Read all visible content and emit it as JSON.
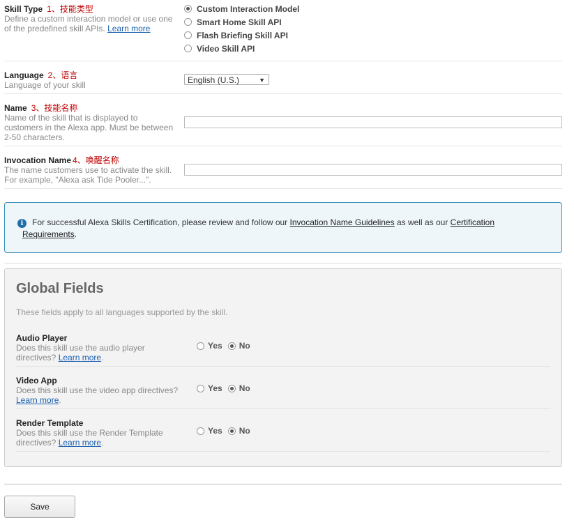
{
  "skill_type": {
    "title": "Skill Type",
    "annotation": "1、技能类型",
    "desc": "Define a custom interaction model or use one of the predefined skill APIs.",
    "learn_more": "Learn more",
    "options": [
      {
        "label": "Custom Interaction Model",
        "checked": true
      },
      {
        "label": "Smart Home Skill API",
        "checked": false
      },
      {
        "label": "Flash Briefing Skill API",
        "checked": false
      },
      {
        "label": "Video Skill API",
        "checked": false
      }
    ]
  },
  "language": {
    "title": "Language",
    "annotation": "2、语言",
    "desc": "Language of your skill",
    "selected": "English (U.S.)"
  },
  "name": {
    "title": "Name",
    "annotation": "3、技能名称",
    "desc": "Name of the skill that is displayed to customers in the Alexa app. Must be between 2-50 characters.",
    "value": ""
  },
  "invocation_name": {
    "title": "Invocation Name",
    "annotation": "4、唤醒名称",
    "desc": "The name customers use to activate the skill. For example, \"Alexa ask Tide Pooler...\".",
    "value": ""
  },
  "notice": {
    "text_before": "For successful Alexa Skills Certification, please review and follow our",
    "link1": "Invocation Name Guidelines",
    "text_middle": "as well as our",
    "link2": "Certification Requirements",
    "text_after": "."
  },
  "global_fields": {
    "title": "Global Fields",
    "subtitle": "These fields apply to all languages supported by the skill.",
    "yes_label": "Yes",
    "no_label": "No",
    "learn_more": "Learn more",
    "rows": [
      {
        "title": "Audio Player",
        "desc": "Does this skill use the audio player directives?",
        "value": "No"
      },
      {
        "title": "Video App",
        "desc": "Does this skill use the video app directives?",
        "value": "No"
      },
      {
        "title": "Render Template",
        "desc": "Does this skill use the Render Template directives?",
        "value": "No"
      }
    ]
  },
  "save_label": "Save"
}
